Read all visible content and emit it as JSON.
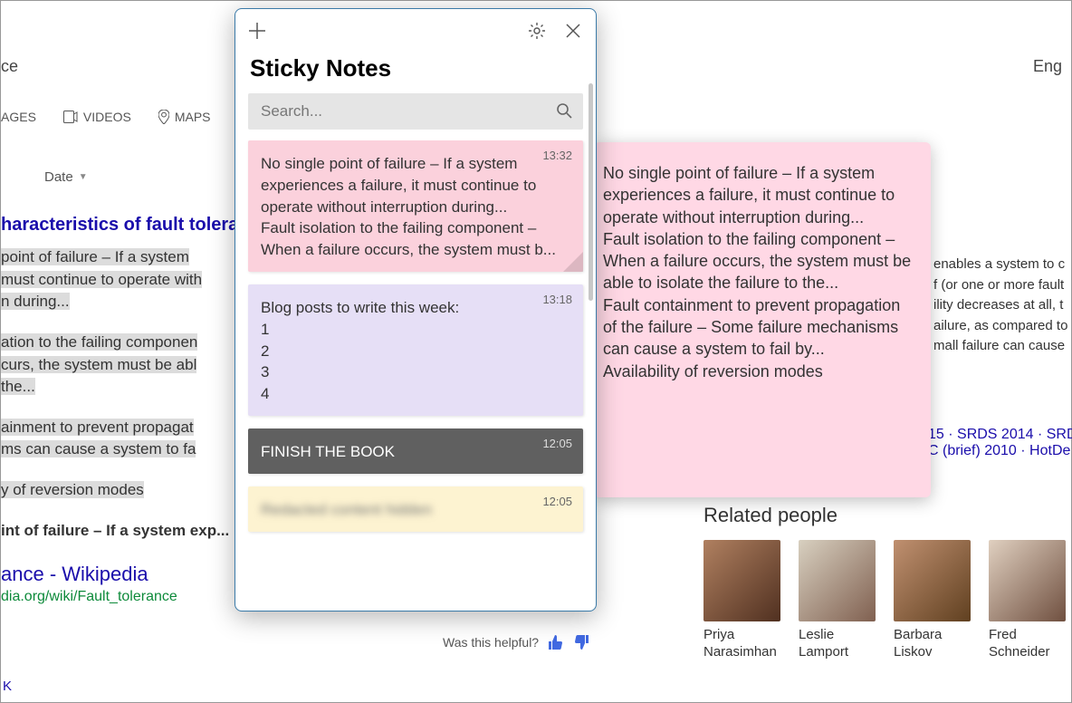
{
  "background": {
    "topright": "Eng",
    "topleft": "ce",
    "tabs": {
      "images": "AGES",
      "videos": "VIDEOS",
      "maps": "MAPS"
    },
    "filter": "Date",
    "result_heading": "haracteristics of fault toleran",
    "snippet_lines": [
      " point of failure – If a system",
      "must continue to operate with",
      "n during..."
    ],
    "snippet2_lines": [
      "ation to the failing componen",
      "curs, the system must be abl",
      "the..."
    ],
    "snippet3_lines": [
      "ainment to prevent propagat",
      "ms can cause a system to fa"
    ],
    "snippet4": "y of reversion modes",
    "snippet5": "int of failure – If a system exp...",
    "second_link": "ance - Wikipedia",
    "url": "dia.org/wiki/Fault_tolerance",
    "k": "K",
    "helpful": "Was this helpful?",
    "right_text": [
      "enables a system to c",
      "f (or one or more fault",
      "ility decreases at all, t",
      "ailure, as compared to",
      "mall failure can cause"
    ],
    "right_links1": "15 · SRDS 2014 · SRD",
    "right_links2": "C (brief) 2010 · HotDe",
    "related_heading": "Related people",
    "people": [
      {
        "name": "Priya Narasimhan"
      },
      {
        "name": "Leslie Lamport"
      },
      {
        "name": "Barbara Liskov"
      },
      {
        "name": "Fred Schneider"
      }
    ]
  },
  "floating_note": {
    "text": "No single point of failure – If a system experiences a failure, it must continue to operate without interruption during...\nFault isolation to the failing component – When a failure occurs, the system must be able to isolate the failure to the...\nFault containment to prevent propagation of the failure – Some failure mechanisms can cause a system to fail by...\nAvailability of reversion modes"
  },
  "sticky": {
    "title": "Sticky Notes",
    "search_placeholder": "Search...",
    "notes": [
      {
        "color": "pink",
        "time": "13:32",
        "body": "No single point of failure – If a system experiences a failure, it must continue to operate without interruption during...\nFault isolation to the failing component – When a failure occurs, the system must b..."
      },
      {
        "color": "purple",
        "time": "13:18",
        "body": "Blog posts to write this week:\n1\n2\n3\n4"
      },
      {
        "color": "dark",
        "time": "12:05",
        "body": "FINISH THE BOOK"
      },
      {
        "color": "yellow",
        "time": "12:05",
        "body": "Redacted content hidden"
      }
    ]
  }
}
